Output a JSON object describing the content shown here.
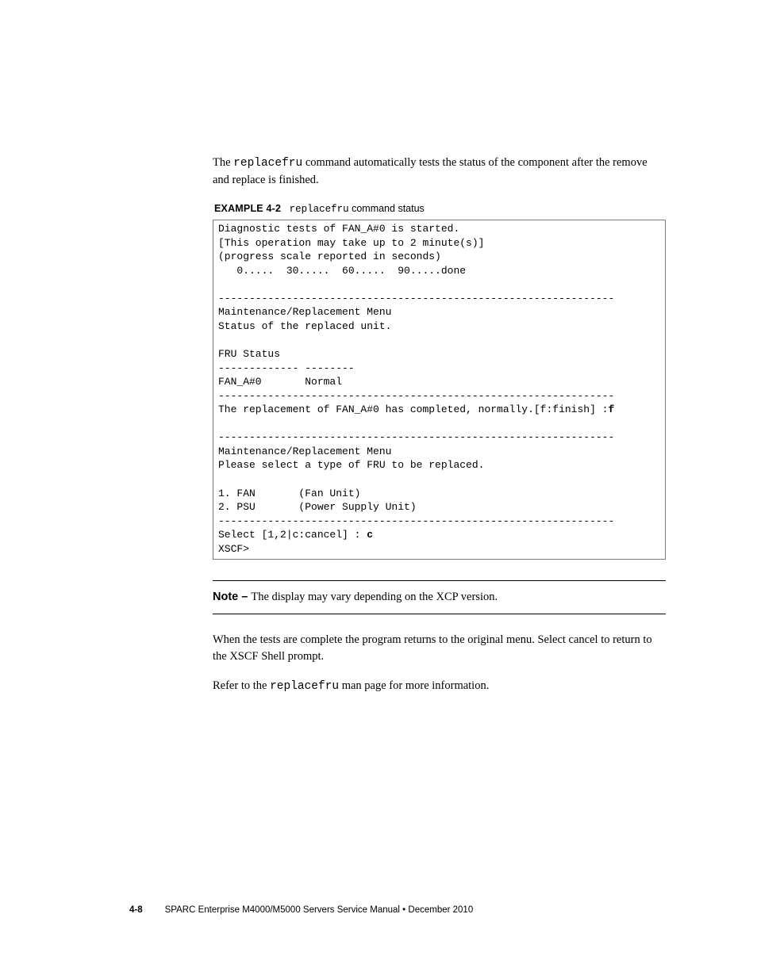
{
  "intro": {
    "pre": "The ",
    "cmd": "replacefru",
    "post": " command automatically tests the status of the component after the remove and replace is finished."
  },
  "example": {
    "label": "EXAMPLE 4-2",
    "cmd": "replacefru",
    "suffix": " command status"
  },
  "code": {
    "l1": "Diagnostic tests of FAN_A#0 is started.",
    "l2": "[This operation may take up to 2 minute(s)]",
    "l3": "(progress scale reported in seconds)",
    "l4": "   0.....  30.....  60.....  90.....done",
    "l5": "",
    "l6": "----------------------------------------------------------------",
    "l7": "Maintenance/Replacement Menu",
    "l8": "Status of the replaced unit.",
    "l9": "",
    "l10": "FRU Status",
    "l11": "------------- --------",
    "l12": "FAN_A#0       Normal",
    "l13": "----------------------------------------------------------------",
    "l14a": "The replacement of FAN_A#0 has completed, normally.[f:finish] :",
    "l14b": "f",
    "l15": "",
    "l16": "----------------------------------------------------------------",
    "l17": "Maintenance/Replacement Menu",
    "l18": "Please select a type of FRU to be replaced.",
    "l19": "",
    "l20": "1. FAN       (Fan Unit)",
    "l21": "2. PSU       (Power Supply Unit)",
    "l22": "----------------------------------------------------------------",
    "l23a": "Select [1,2|c:cancel] : ",
    "l23b": "c",
    "l24": "XSCF>"
  },
  "note": {
    "label": "Note – ",
    "text": "The display may vary depending on the XCP version."
  },
  "para2": "When the tests are complete the program returns to the original menu. Select cancel to return to the XSCF Shell prompt.",
  "para3": {
    "pre": "Refer to the ",
    "cmd": "replacefru",
    "post": " man page for more information."
  },
  "footer": {
    "pagenum": "4-8",
    "title": "SPARC Enterprise M4000/M5000 Servers Service Manual  •  December 2010"
  }
}
